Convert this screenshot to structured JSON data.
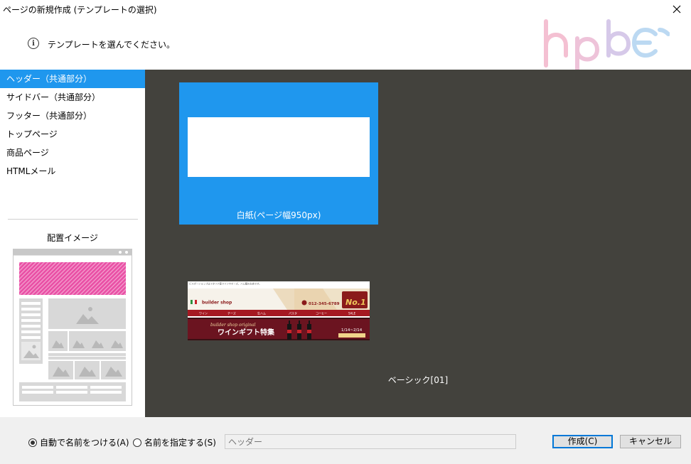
{
  "window": {
    "title": "ページの新規作成 (テンプレートの選択)"
  },
  "header": {
    "instruction": "テンプレートを選んでください。",
    "logo_text": "hpbec",
    "logo_colors": [
      "#f4c0d2",
      "#bcd9f2"
    ]
  },
  "sidebar": {
    "items": [
      {
        "label": "ヘッダー（共通部分）",
        "selected": true
      },
      {
        "label": "サイドバー（共通部分）",
        "selected": false
      },
      {
        "label": "フッター（共通部分）",
        "selected": false
      },
      {
        "label": "トップページ",
        "selected": false
      },
      {
        "label": "商品ページ",
        "selected": false
      },
      {
        "label": "HTMLメール",
        "selected": false
      }
    ],
    "preview_title": "配置イメージ",
    "highlight_color": "#e94fa5"
  },
  "templates": [
    {
      "caption": "白紙(ページ幅950px)",
      "selected": true
    },
    {
      "caption": "ベーシック[01]",
      "selected": false,
      "thumbnail": {
        "top_text": "ビルダーショップはイタリア産ワインやチーズ、ハム類のお店です。",
        "shop_name": "builder shop",
        "phone": "012-345-6789",
        "badge": "No.1",
        "nav": [
          "ワイン",
          "チーズ",
          "生ハム",
          "パスタ",
          "コーヒー",
          "SALE"
        ],
        "banner_sub": "builder shop original",
        "banner_title": "ワインギフト特集",
        "banner_date": "1/14~2/14"
      }
    }
  ],
  "bottom": {
    "radio_auto": "自動で名前をつける(A)",
    "radio_manual": "名前を指定する(S)",
    "auto_checked": true,
    "name_placeholder": "ヘッダー",
    "create_button": "作成(C)",
    "cancel_button": "キャンセル"
  },
  "colors": {
    "accent": "#1f97ee",
    "canvas": "#43423d"
  }
}
